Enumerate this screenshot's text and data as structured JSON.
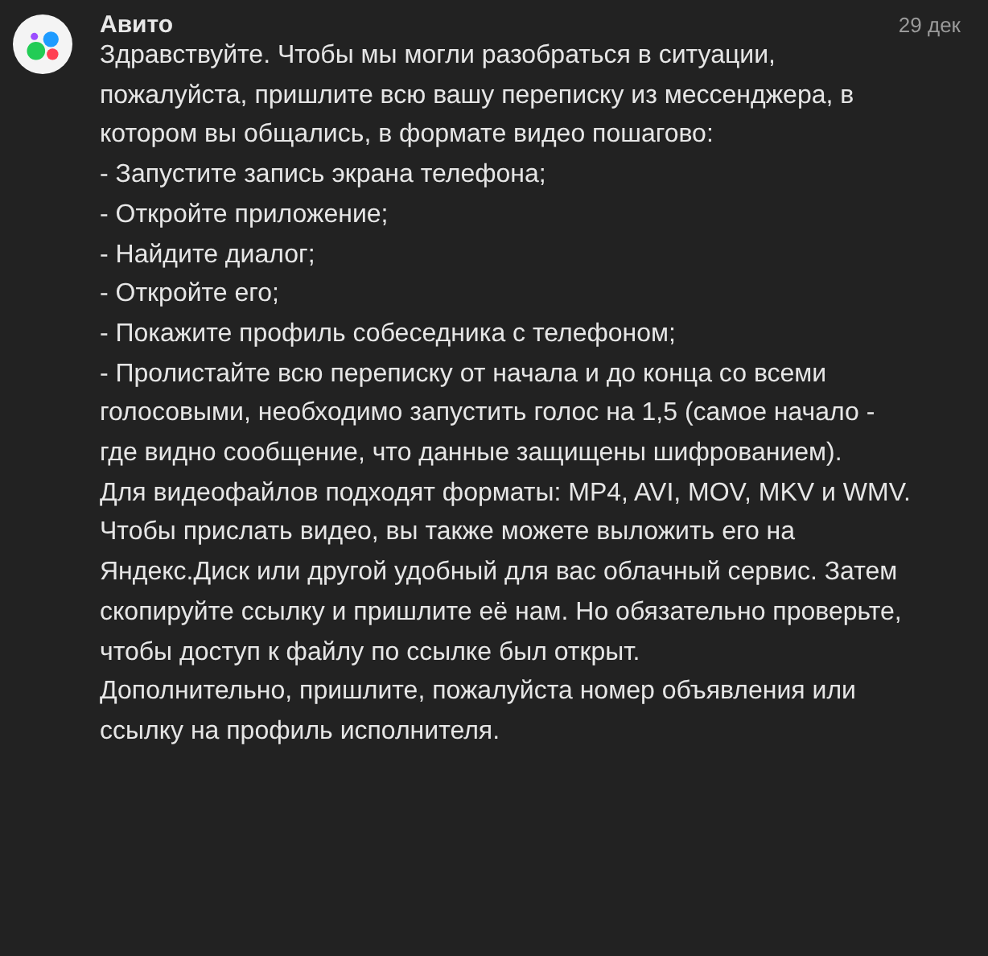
{
  "message": {
    "sender": "Авито",
    "date": "29 дек",
    "paragraphs": [
      "Здравствуйте. Чтобы мы могли разобраться в ситуации, пожалуйста, пришлите всю вашу переписку из мессенджера, в котором вы общались, в формате видео пошагово:",
      "- Запустите запись экрана телефона;",
      "- Откройте приложение;",
      "- Найдите диалог;",
      "- Откройте его;",
      "- Покажите профиль собеседника с телефоном;",
      "- Пролистайте всю переписку от начала и до конца со всеми голосовыми, необходимо запустить голос на 1,5 (самое начало - где видно сообщение, что данные защищены шифрованием).",
      "Для видеофайлов подходят форматы: MP4, AVI, MOV, MKV и WMV. Чтобы прислать видео, вы также можете выложить его на Яндекс.Диск или другой удобный для вас облачный сервис. Затем скопируйте ссылку и пришлите её нам. Но обязательно проверьте, чтобы доступ к файлу по ссылке был открыт.",
      "Дополнительно, пришлите, пожалуйста номер объявления или ссылку на профиль исполнителя."
    ]
  }
}
